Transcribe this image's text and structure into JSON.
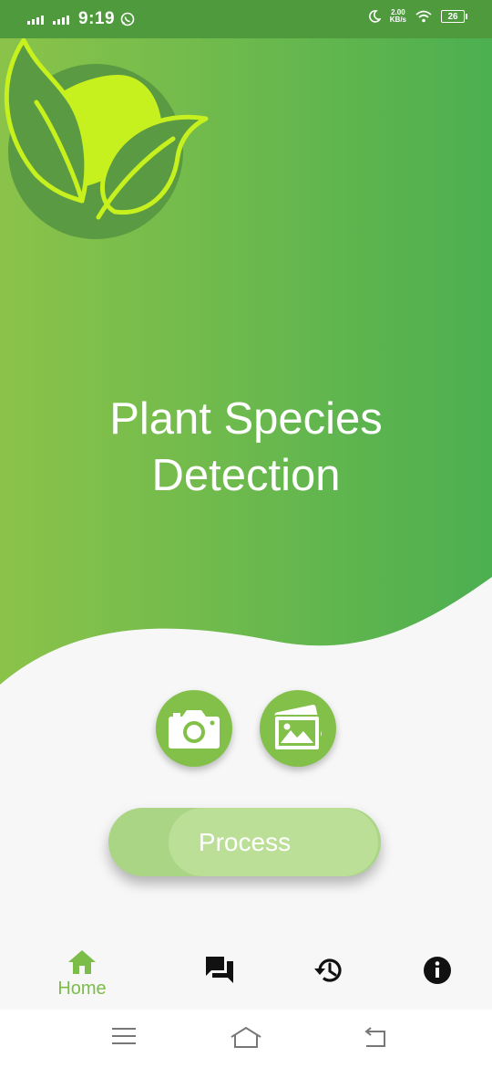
{
  "status_bar": {
    "time": "9:19",
    "net_speed_value": "2.00",
    "net_speed_unit": "KB/s",
    "battery": "26",
    "icons": [
      "signal-icon",
      "signal-icon",
      "whatsapp-icon",
      "moon-icon",
      "wifi-icon",
      "battery-icon"
    ]
  },
  "hero": {
    "title_line1": "Plant Species",
    "title_line2": "Detection",
    "logo_icon": "leaf-logo-icon",
    "colors": {
      "gradient_start": "#8bc34a",
      "gradient_end": "#4caf50",
      "logo_circle": "#5a9a43",
      "logo_sun": "#c6f01e"
    }
  },
  "actions": {
    "camera_icon": "camera-icon",
    "gallery_icon": "gallery-icon",
    "process_label": "Process"
  },
  "bottom_nav": {
    "items": [
      {
        "label": "Home",
        "icon": "home-icon",
        "active": true
      },
      {
        "label": "",
        "icon": "chat-icon",
        "active": false
      },
      {
        "label": "",
        "icon": "history-icon",
        "active": false
      },
      {
        "label": "",
        "icon": "info-icon",
        "active": false
      }
    ],
    "accent": "#7bbd48"
  },
  "system_nav": {
    "icons": [
      "menu-icon",
      "home-outline-icon",
      "back-icon"
    ]
  }
}
